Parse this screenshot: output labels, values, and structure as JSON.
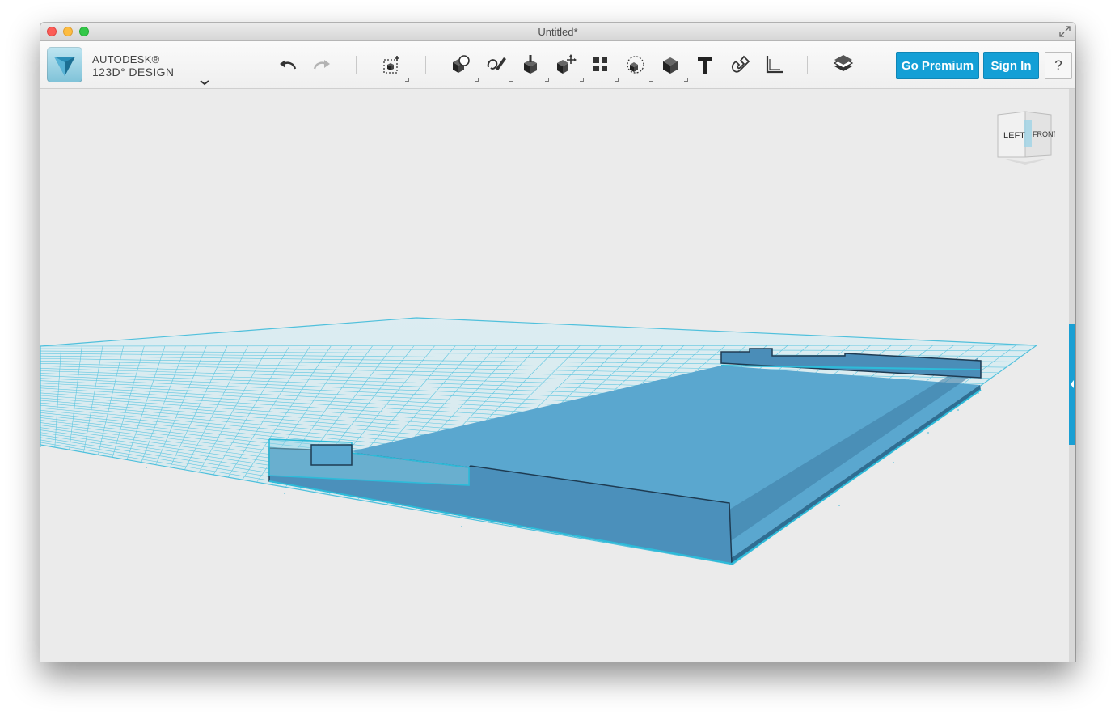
{
  "window": {
    "title": "Untitled*"
  },
  "brand": {
    "line1": "AUTODESK®",
    "line2": "123D° DESIGN"
  },
  "toolbar": {
    "menu_icon": "chevron-down-icon",
    "undo_icon": "undo-icon",
    "redo_icon": "redo-icon",
    "tools": [
      "transform-icon",
      "primitives-icon",
      "sketch-icon",
      "construct-icon",
      "modify-icon",
      "pattern-icon",
      "group-icon",
      "combine-icon",
      "text-icon",
      "snap-icon",
      "measure-icon",
      "materials-icon"
    ],
    "go_premium_label": "Go Premium",
    "sign_in_label": "Sign In",
    "help_label": "?"
  },
  "viewcube": {
    "left_label": "LEFT",
    "front_label": "FRONT"
  },
  "colors": {
    "accent": "#149fd6",
    "model": "#4b95c0",
    "grid": "#4fc0dc"
  }
}
